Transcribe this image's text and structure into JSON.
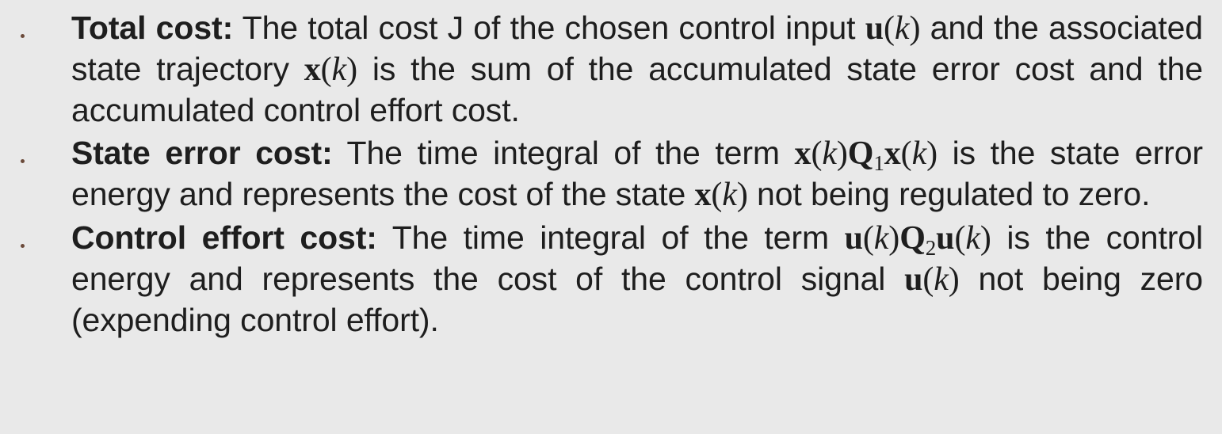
{
  "bullets": [
    {
      "term": "Total cost:",
      "t1": " The total cost J of the chosen control input ",
      "m1": {
        "sym": "u",
        "open": "(",
        "var": "k",
        "close": ")"
      },
      "t2": " and the associated state trajectory ",
      "m2": {
        "sym": "x",
        "open": "(",
        "var": "k",
        "close": ")"
      },
      "t3": " is the sum of the accumulated state error cost and the accumulated control effort cost."
    },
    {
      "term": "State error cost:",
      "t1": " The time integral of the term ",
      "m1": {
        "a": "x",
        "open": "(",
        "var": "k",
        "close": ")",
        "q": "Q",
        "qsub": "1",
        "b": "x",
        "open2": "(",
        "var2": "k",
        "close2": ")"
      },
      "t2": " is the state error energy and represents the cost of the state ",
      "m2": {
        "sym": "x",
        "open": "(",
        "var": "k",
        "close": ")"
      },
      "t3": " not being regulated to zero."
    },
    {
      "term": "Control effort cost:",
      "t1": " The time integral of the term ",
      "m1": {
        "a": "u",
        "open": "(",
        "var": "k",
        "close": ")",
        "q": "Q",
        "qsub": "2",
        "b": "u",
        "open2": "(",
        "var2": "k",
        "close2": ")"
      },
      "t2": " is the control energy and represents the cost of the control signal ",
      "m2": {
        "sym": "u",
        "open": "(",
        "var": "k",
        "close": ")"
      },
      "t3": " not being zero (expending control effort)."
    }
  ]
}
